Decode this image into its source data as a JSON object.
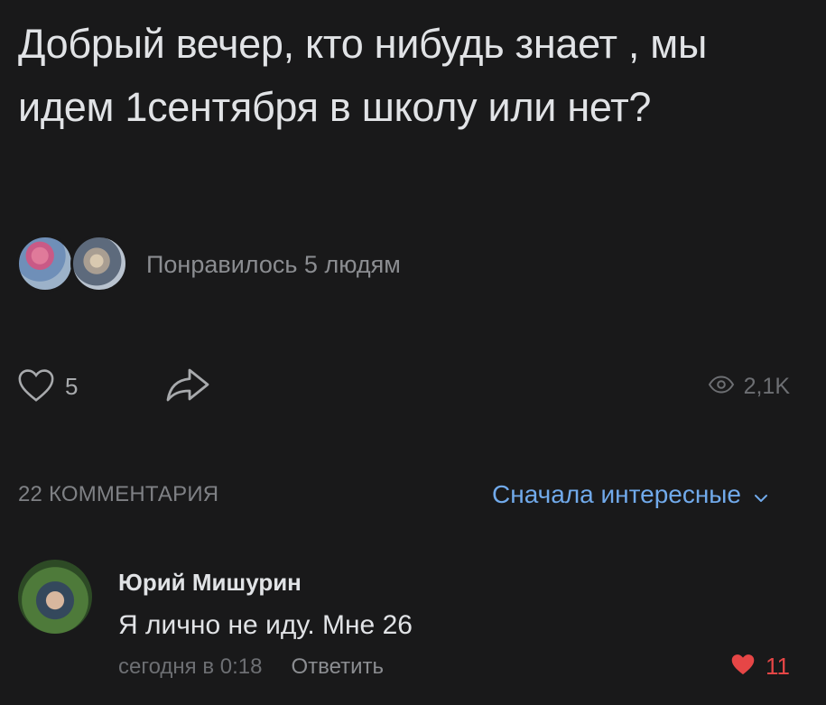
{
  "post": {
    "text": "Добрый вечер, кто нибудь знает , мы идем 1сентября в школу или нет?"
  },
  "likers": {
    "text": "Понравилось 5 людям"
  },
  "actions": {
    "like_count": "5",
    "views": "2,1K"
  },
  "comments_header": {
    "count_label": "22 КОММЕНТАРИЯ",
    "sort_label": "Сначала интересные"
  },
  "comment": {
    "author": "Юрий Мишурин",
    "text": "Я лично не иду. Мне 26",
    "time": "сегодня в 0:18",
    "reply_label": "Ответить",
    "like_count": "11"
  },
  "colors": {
    "background": "#19191a",
    "accent": "#71aaeb",
    "like_red": "#e64646"
  },
  "icons": [
    "heart-icon",
    "share-icon",
    "eye-icon",
    "chevron-down-icon",
    "heart-filled-icon"
  ]
}
